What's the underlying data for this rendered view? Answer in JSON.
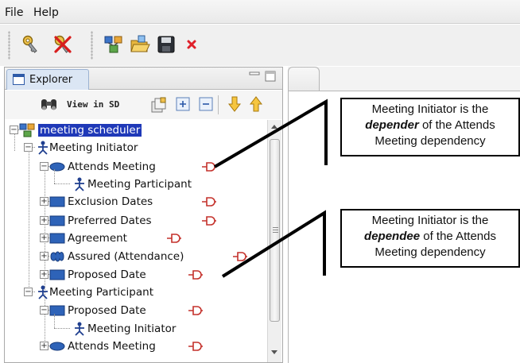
{
  "menu": {
    "file": "File",
    "help": "Help"
  },
  "toolbar_icons": [
    "key-icon",
    "delete-key-icon",
    "model-icon",
    "open-folder-icon",
    "save-icon",
    "close-icon"
  ],
  "explorer": {
    "tab_label": "Explorer",
    "view_label": "View in SD"
  },
  "tree": [
    {
      "label": "meeting scheduler",
      "icon": "model-icon",
      "selected": true
    },
    {
      "label": "Meeting Initiator",
      "icon": "actor-icon"
    },
    {
      "label": "Attends Meeting",
      "icon": "goal-icon"
    },
    {
      "label": "Meeting Participant",
      "icon": "actor-icon"
    },
    {
      "label": "Exclusion Dates",
      "icon": "resource-icon"
    },
    {
      "label": "Preferred Dates",
      "icon": "resource-icon"
    },
    {
      "label": "Agreement",
      "icon": "resource-icon"
    },
    {
      "label": "Assured (Attendance)",
      "icon": "softgoal-icon"
    },
    {
      "label": "Proposed Date",
      "icon": "resource-icon"
    },
    {
      "label": "Meeting Participant",
      "icon": "actor-icon"
    },
    {
      "label": "Proposed Date",
      "icon": "resource-icon"
    },
    {
      "label": "Meeting Initiator",
      "icon": "actor-icon"
    },
    {
      "label": "Attends Meeting",
      "icon": "goal-icon"
    }
  ],
  "callout_depender": {
    "l1": "Meeting Initiator  is the",
    "l2_bold": "depender",
    "l2_rest": " of the Attends",
    "l3": "Meeting dependency"
  },
  "callout_dependee": {
    "l1": "Meeting Initiator  is the",
    "l2_bold": "dependee",
    "l2_rest": " of the Attends",
    "l3": "Meeting dependency"
  }
}
